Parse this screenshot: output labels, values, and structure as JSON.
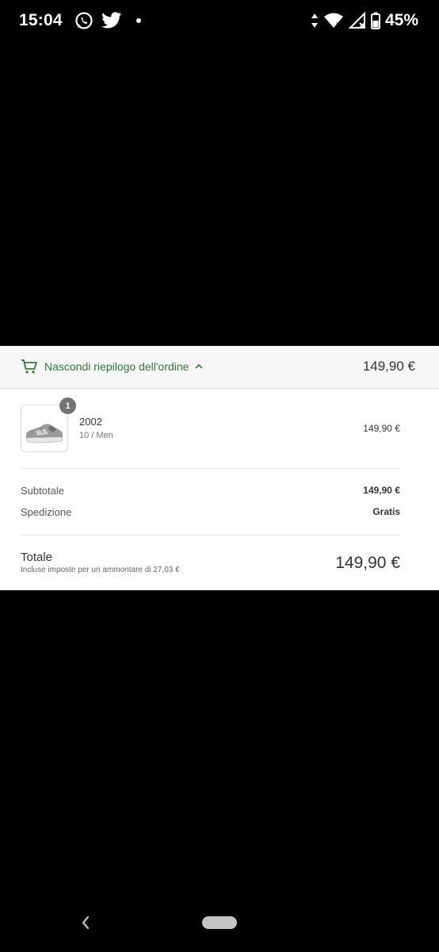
{
  "status_bar": {
    "time": "15:04",
    "battery_percent": "45%",
    "icons": [
      "whatsapp-icon",
      "twitter-icon",
      "notification-dot",
      "data-arrows-icon",
      "wifi-icon",
      "signal-icon",
      "battery-icon"
    ]
  },
  "order_summary": {
    "toggle_label": "Nascondi riepilogo dell'ordine",
    "header_total": "149,90 €",
    "accent_color": "#2e7d32",
    "product": {
      "quantity": "1",
      "name": "2002",
      "variant": "10 / Men",
      "price": "149,90 €"
    },
    "subtotal": {
      "label": "Subtotale",
      "value": "149,90 €"
    },
    "shipping": {
      "label": "Spedizione",
      "value": "Gratis"
    },
    "total": {
      "label": "Totale",
      "tax_note": "Incluse imposte per un ammontare di 27,03 €",
      "value": "149,90 €"
    }
  }
}
